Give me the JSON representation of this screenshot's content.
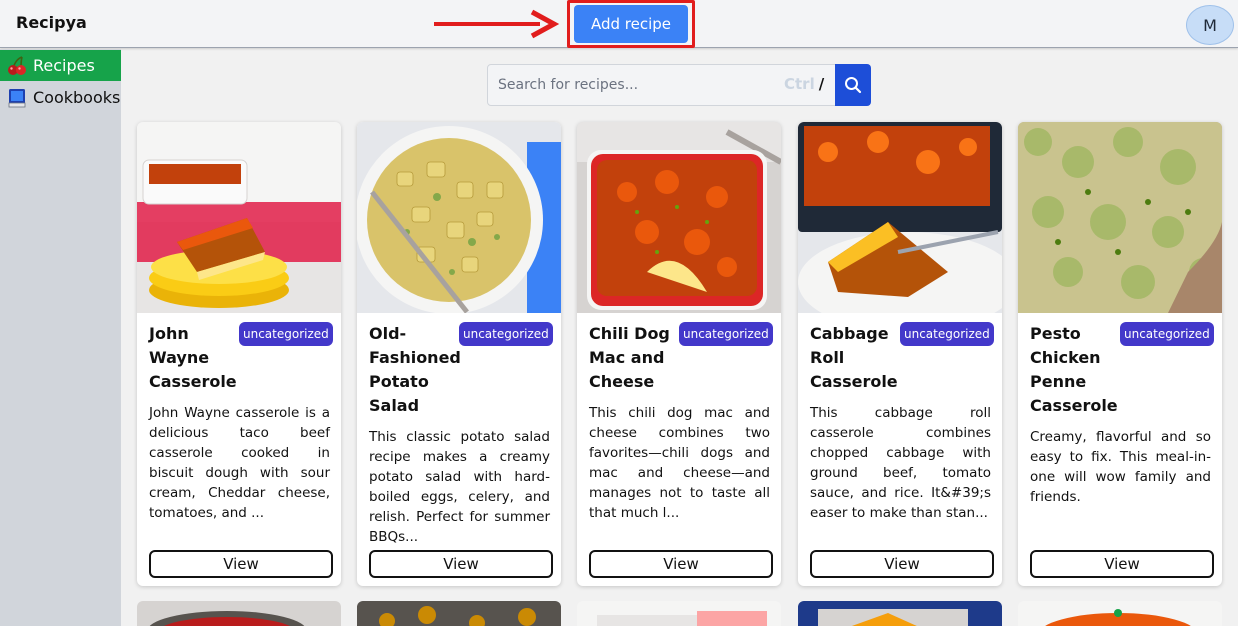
{
  "header": {
    "brand": "Recipya",
    "add_recipe_label": "Add recipe",
    "avatar_initial": "M"
  },
  "sidebar": {
    "items": [
      {
        "label": "Recipes",
        "icon": "cherries-icon",
        "active": true
      },
      {
        "label": "Cookbooks",
        "icon": "book-icon",
        "active": false
      }
    ]
  },
  "search": {
    "placeholder": "Search for recipes...",
    "shortcut_ctrl": "Ctrl",
    "shortcut_key": "/"
  },
  "recipes": [
    {
      "title": "John Wayne Casserole",
      "category": "uncategorized",
      "description": "John Wayne casserole is a delicious taco beef casserole cooked in biscuit dough with sour cream, Cheddar cheese, tomatoes, and ...",
      "view_label": "View"
    },
    {
      "title": "Old-Fashioned Potato Salad",
      "category": "uncategorized",
      "description": "This classic potato salad recipe makes a creamy potato salad with hard-boiled eggs, celery, and relish. Perfect for summer BBQs...",
      "view_label": "View"
    },
    {
      "title": "Chili Dog Mac and Cheese",
      "category": "uncategorized",
      "description": "This chili dog mac and cheese combines two favorites—chili dogs and mac and cheese—and manages not to taste all that much l...",
      "view_label": "View"
    },
    {
      "title": "Cabbage Roll Casserole",
      "category": "uncategorized",
      "description": "This cabbage roll casserole combines chopped cabbage with ground beef, tomato sauce, and rice. It&#39;s easer to make than stan...",
      "view_label": "View"
    },
    {
      "title": "Pesto Chicken Penne Casserole",
      "category": "uncategorized",
      "description": "Creamy, flavorful and so easy to fix. This meal-in-one will wow family and friends.",
      "view_label": "View"
    }
  ],
  "colors": {
    "primary": "#3b82f6",
    "active_sidebar": "#16a34a",
    "badge": "#4338ca",
    "annotation": "#e11d1d"
  }
}
